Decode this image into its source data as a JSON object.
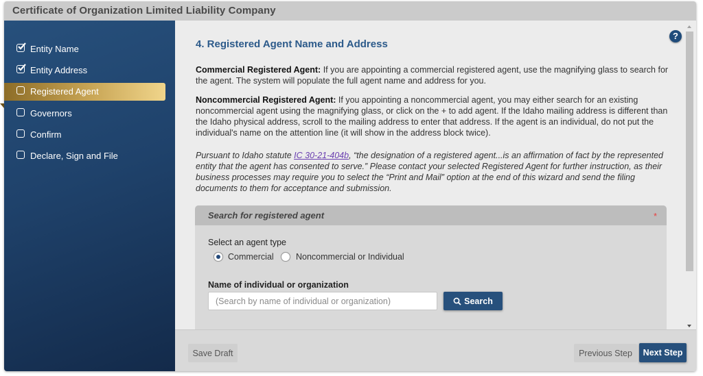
{
  "window": {
    "title": "Certificate of Organization Limited Liability Company"
  },
  "sidebar": {
    "items": [
      {
        "label": "Entity Name",
        "checked": true,
        "active": false
      },
      {
        "label": "Entity Address",
        "checked": true,
        "active": false
      },
      {
        "label": "Registered Agent",
        "checked": false,
        "active": true
      },
      {
        "label": "Governors",
        "checked": false,
        "active": false
      },
      {
        "label": "Confirm",
        "checked": false,
        "active": false
      },
      {
        "label": "Declare, Sign and File",
        "checked": false,
        "active": false
      }
    ]
  },
  "main": {
    "help_label": "?",
    "heading": "4. Registered Agent Name and Address",
    "commercial": {
      "title": "Commercial Registered Agent:",
      "text": " If you are appointing a commercial registered agent, use the magnifying glass to search for the agent.  The system will populate the full agent name and address for you."
    },
    "noncommercial": {
      "title": "Noncommercial Registered Agent:",
      "text": " If you appointing a noncommercial agent, you may either search for an existing noncommercial agent using the magnifying glass, or click on the + to add agent.  If the Idaho mailing address is different than the Idaho physical address, scroll to the mailing address to enter that address.  If the agent is an individual, do not put the individual's name on the attention line (it will show in the address block twice)."
    },
    "statute": {
      "prefix": "Pursuant to Idaho statute ",
      "link": "IC 30-21-404b",
      "text": ", “the designation of a registered agent...is an affirmation of fact by the represented entity that the agent has consented to serve.” Please contact your selected Registered Agent for further instruction, as their business processes may require you to select the “Print and Mail” option at the end of this wizard and send the filing documents to them for acceptance and submission."
    },
    "panel": {
      "title": "Search for registered agent",
      "required_mark": "*",
      "agent_type_label": "Select an agent type",
      "options": [
        {
          "label": "Commercial",
          "selected": true
        },
        {
          "label": "Noncommercial or Individual",
          "selected": false
        }
      ],
      "name_label": "Name of individual or organization",
      "search_value": "",
      "search_placeholder": "(Search by name of individual or organization)",
      "search_button": "Search"
    }
  },
  "footer": {
    "save_draft": "Save Draft",
    "previous_step": "Previous Step",
    "next_step": "Next Step"
  },
  "colors": {
    "brand_blue": "#27507c",
    "active_gold": "#c9a656",
    "required": "#e84040",
    "link": "#6a3fb0"
  }
}
